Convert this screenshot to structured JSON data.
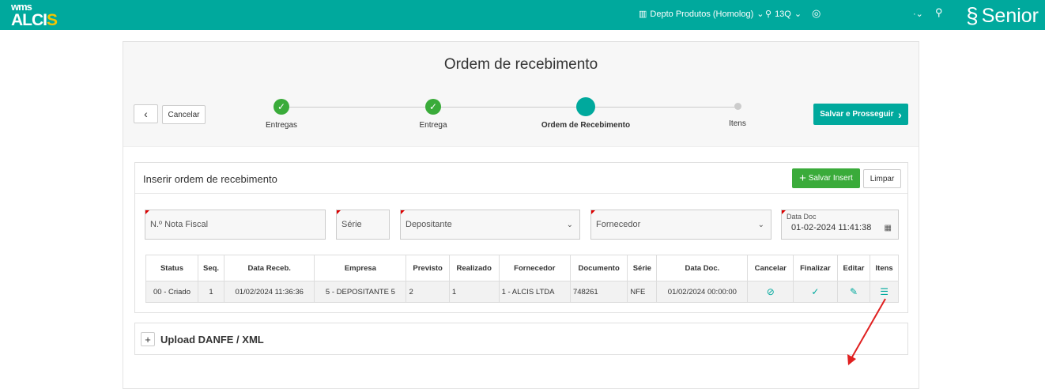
{
  "topbar": {
    "logo_top": "wms",
    "logo_main": "ALCI",
    "logo_accent": "S",
    "depot": "Depto Produtos (Homolog)",
    "location": "13Q",
    "brand": "Senior"
  },
  "header": {
    "title": "Ordem de recebimento",
    "cancel": "Cancelar",
    "save_next": "Salvar e Prosseguir",
    "steps": [
      {
        "label": "Entregas",
        "state": "done"
      },
      {
        "label": "Entrega",
        "state": "done"
      },
      {
        "label": "Ordem de Recebimento",
        "state": "active"
      },
      {
        "label": "Itens",
        "state": "pending"
      }
    ]
  },
  "insert": {
    "title": "Inserir ordem de recebimento",
    "save_insert": "Salvar Insert",
    "clear": "Limpar",
    "fields": {
      "nota": "N.º Nota Fiscal",
      "serie": "Série",
      "depositante": "Depositante",
      "fornecedor": "Fornecedor",
      "data_doc_label": "Data Doc",
      "data_doc_value": "01-02-2024 11:41:38"
    }
  },
  "table": {
    "columns": [
      "Status",
      "Seq.",
      "Data Receb.",
      "Empresa",
      "Previsto",
      "Realizado",
      "Fornecedor",
      "Documento",
      "Série",
      "Data Doc.",
      "Cancelar",
      "Finalizar",
      "Editar",
      "Itens"
    ],
    "rows": [
      [
        "00 - Criado",
        "1",
        "01/02/2024 11:36:36",
        "5 - DEPOSITANTE 5",
        "2",
        "1",
        "1 - ALCIS LTDA",
        "748261",
        "NFE",
        "01/02/2024 00:00:00"
      ]
    ]
  },
  "upload": {
    "title": "Upload DANFE / XML"
  },
  "colors": {
    "brand": "#00a99d",
    "success": "#3aab3a",
    "annotation": "#e02020"
  }
}
